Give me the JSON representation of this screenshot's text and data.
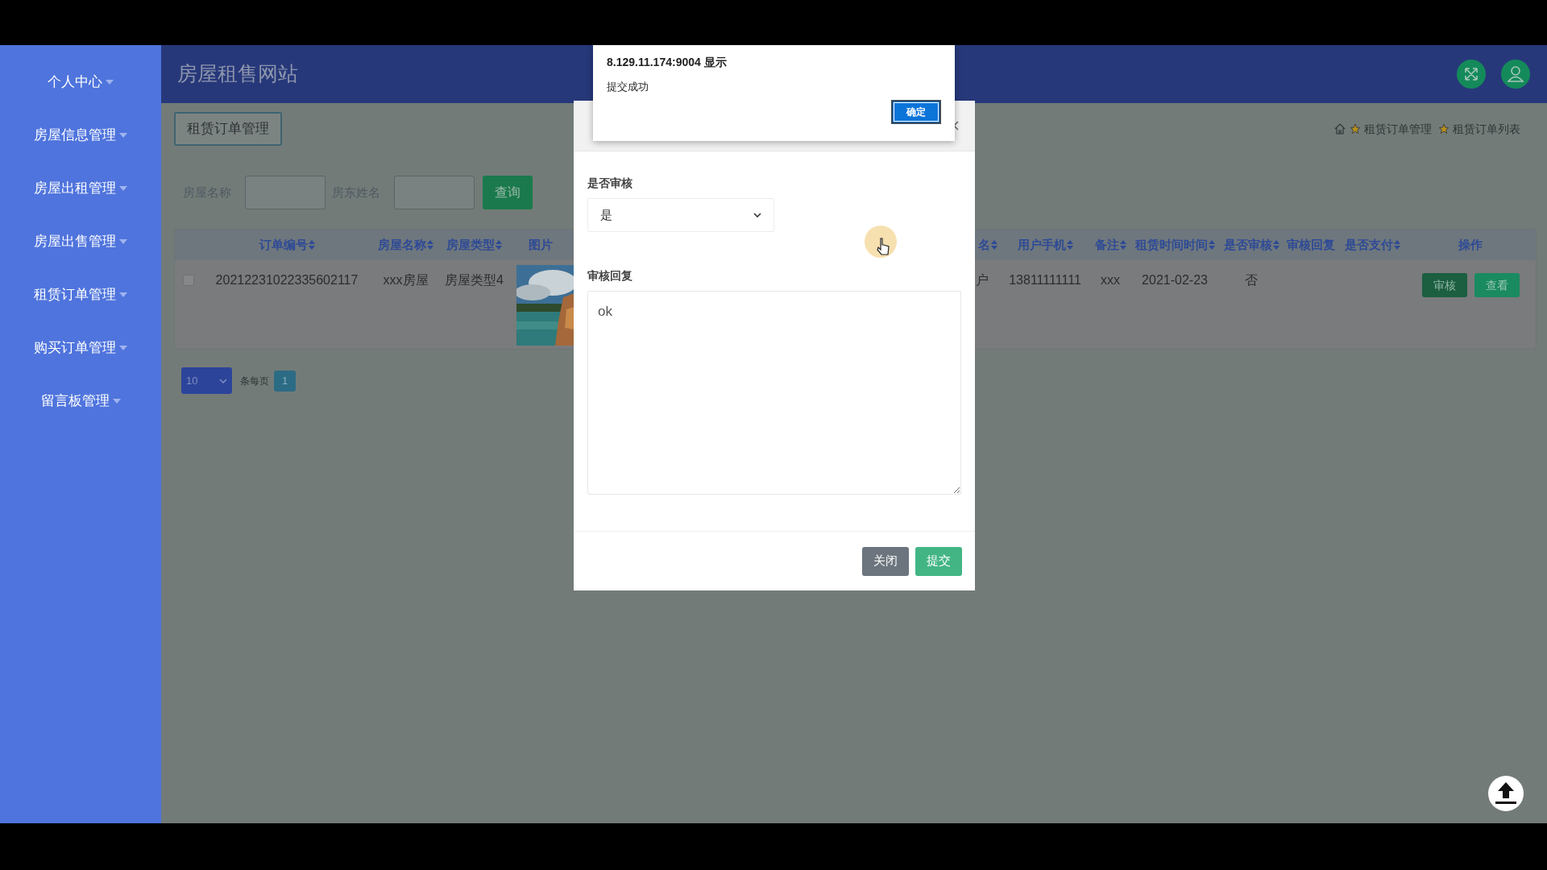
{
  "sidebar": {
    "items": [
      {
        "label": "个人中心"
      },
      {
        "label": "房屋信息管理"
      },
      {
        "label": "房屋出租管理"
      },
      {
        "label": "房屋出售管理"
      },
      {
        "label": "租赁订单管理"
      },
      {
        "label": "购买订单管理"
      },
      {
        "label": "留言板管理"
      }
    ]
  },
  "header": {
    "title": "房屋租售网站"
  },
  "page": {
    "tab_button": "租赁订单管理",
    "breadcrumb": [
      "租赁订单管理",
      "租赁订单列表"
    ]
  },
  "search": {
    "fields": [
      {
        "label": "房屋名称"
      },
      {
        "label": "房东姓名"
      }
    ],
    "button": "查询"
  },
  "table": {
    "columns": [
      {
        "label": "订单编号",
        "sortable": true
      },
      {
        "label": "房屋名称",
        "sortable": true
      },
      {
        "label": "房屋类型",
        "sortable": true
      },
      {
        "label": "图片",
        "sortable": false
      },
      {
        "label": "名",
        "sortable": true
      },
      {
        "label": "用户手机",
        "sortable": true
      },
      {
        "label": "备注",
        "sortable": true
      },
      {
        "label": "租赁时间时间",
        "sortable": true
      },
      {
        "label": "是否审核",
        "sortable": true
      },
      {
        "label": "审核回复",
        "sortable": false
      },
      {
        "label": "是否支付",
        "sortable": true
      },
      {
        "label": "操作",
        "sortable": false
      }
    ],
    "rows": [
      {
        "checked": false,
        "cells": [
          {
            "kind": "text",
            "text": "20212231022335602117"
          },
          {
            "kind": "text",
            "text": "xxx房屋"
          },
          {
            "kind": "text",
            "text": "房屋类型4"
          },
          {
            "kind": "picture"
          },
          {
            "kind": "text",
            "text": "户"
          },
          {
            "kind": "text",
            "text": "13811111111"
          },
          {
            "kind": "text",
            "text": "xxx"
          },
          {
            "kind": "text",
            "text": "2021-02-23"
          },
          {
            "kind": "text",
            "text": "否"
          },
          {
            "kind": "blank"
          },
          {
            "kind": "blank"
          }
        ],
        "actions": [
          {
            "kind": "dark",
            "label": "审核"
          },
          {
            "kind": "light",
            "label": "查看"
          }
        ]
      }
    ]
  },
  "pagination": {
    "page_size": "10",
    "per_page_label": "条每页",
    "pages": [
      {
        "label": "1",
        "selected": true
      }
    ]
  },
  "dialog": {
    "fields": [
      {
        "kind": "select",
        "label": "是否审核",
        "value": "是"
      },
      {
        "kind": "textarea",
        "label": "审核回复",
        "value": "ok"
      }
    ],
    "buttons": [
      {
        "kind": "secondary",
        "label": "关闭"
      },
      {
        "kind": "primary",
        "label": "提交"
      }
    ]
  },
  "alert": {
    "title": "8.129.11.174:9004 显示",
    "message": "提交成功",
    "button": "确定"
  }
}
